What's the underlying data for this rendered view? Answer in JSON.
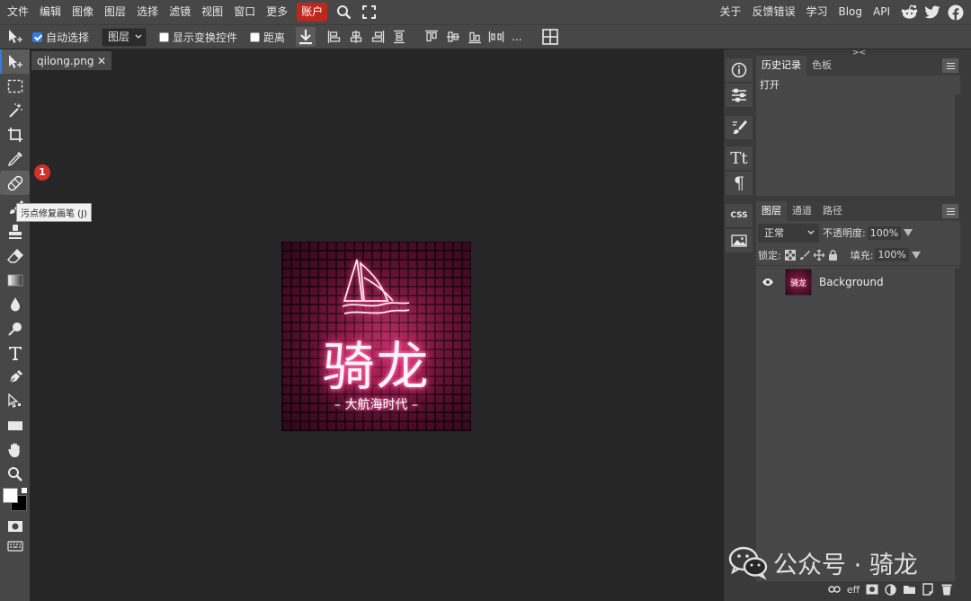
{
  "menu": {
    "items": [
      "文件",
      "编辑",
      "图像",
      "图层",
      "选择",
      "滤镜",
      "视图",
      "窗口",
      "更多"
    ],
    "account": "账户",
    "right_items": [
      "关于",
      "反馈错误",
      "学习",
      "Blog",
      "API"
    ],
    "social_icons": [
      "reddit-icon",
      "twitter-icon",
      "facebook-icon"
    ]
  },
  "options": {
    "auto_select_label": "自动选择",
    "auto_select_checked": true,
    "layer_select_value": "图层",
    "show_transform_label": "显示变换控件",
    "distance_label": "距离",
    "more_label": "..."
  },
  "document": {
    "tab_title": "qilong.png",
    "close_glyph": "✕"
  },
  "canvas": {
    "logo_title": "骑龙",
    "logo_subtitle": "– 大航海时代 –"
  },
  "annotation": {
    "badge": "1",
    "tooltip": "污点修复画笔 (J)"
  },
  "history_panel": {
    "tabs": [
      "历史记录",
      "色板"
    ],
    "items": [
      "打开"
    ]
  },
  "layers_panel": {
    "tabs": [
      "图层",
      "通道",
      "路径"
    ],
    "blend_mode": "正常",
    "opacity_label": "不透明度:",
    "opacity_value": "100%",
    "lock_label": "锁定:",
    "fill_label": "填充:",
    "fill_value": "100%",
    "layers": [
      {
        "name": "Background",
        "visible": true,
        "thumb_text": "骑龙"
      }
    ],
    "footer": {
      "eff_label": "eff"
    }
  },
  "strip": {
    "css_label": "CSS",
    "collapse_left": "<>",
    "collapse_right": "><"
  },
  "watermark": {
    "text": "公众号 · 骑龙"
  },
  "colors": {
    "accent": "#2f7de1",
    "account_bg": "#c0271c",
    "badge_bg": "#d23127",
    "app_bg": "#262626",
    "panel_bg": "#474747"
  }
}
